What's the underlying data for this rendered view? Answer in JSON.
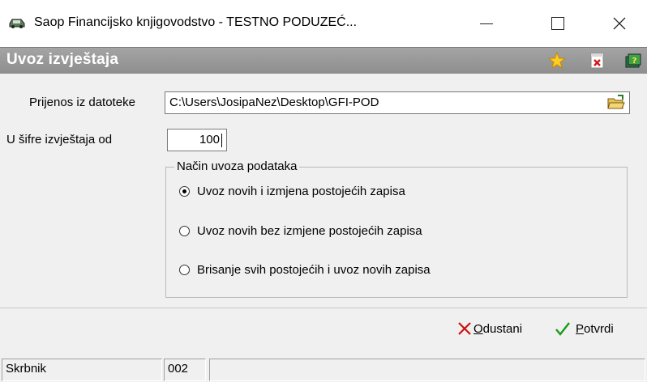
{
  "window": {
    "title": "Saop Financijsko knjigovodstvo - TESTNO PODUZEĆ...",
    "app_icon": "car-icon",
    "controls": [
      "minimize-icon",
      "maximize-icon",
      "close-icon"
    ]
  },
  "header": {
    "title": "Uvoz izvještaja",
    "icons": [
      "star-icon",
      "pdf-close-icon",
      "book-help-icon"
    ]
  },
  "form": {
    "file_label": "Prijenos iz datoteke",
    "file_value": "C:\\Users\\JosipaNez\\Desktop\\GFI-POD",
    "browse_icon": "folder-open-icon",
    "code_label": "U šifre izvještaja od",
    "code_value": "100"
  },
  "import_mode": {
    "legend": "Način uvoza podataka",
    "options": [
      {
        "label": "Uvoz novih i izmjena postojećih zapisa",
        "selected": true
      },
      {
        "label": "Uvoz novih bez izmjene postojećih zapisa",
        "selected": false
      },
      {
        "label": "Brisanje svih postojećih i uvoz novih zapisa",
        "selected": false
      }
    ]
  },
  "footer": {
    "cancel_u": "O",
    "cancel_rest": "dustani",
    "confirm_u": "P",
    "confirm_rest": "otvrdi",
    "colors": {
      "cancel": "#cc1111",
      "confirm": "#1a9a1a"
    }
  },
  "status": {
    "user": "Skrbnik",
    "code": "002",
    "extra": ""
  }
}
